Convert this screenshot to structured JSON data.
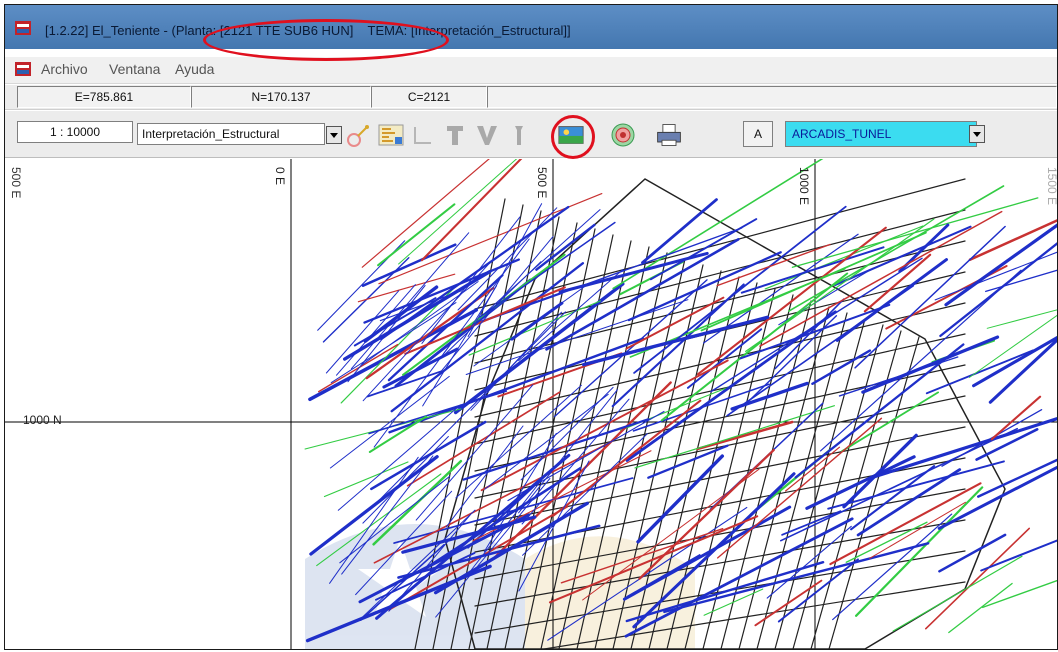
{
  "window": {
    "title_prefix": "[1.2.22] El_Teniente - ",
    "title_planta": "(Planta: [2121 TTE SUB6 HUN]",
    "title_tema": "    TEMA: [Interpretación_Estructural]]"
  },
  "menu": [
    "Archivo",
    "Ventana",
    "Ayuda"
  ],
  "status": {
    "east": "E=785.861",
    "north": "N=170.137",
    "cota": "C=2121"
  },
  "toolbar": {
    "scale": "1 : 10000",
    "theme_select": "Interpretación_Estructural",
    "font_button": "A",
    "layer_select": "ARCADIS_TUNEL"
  },
  "map": {
    "grid_labels": {
      "x_neg": "500 E",
      "x_zero": "0 E",
      "x_500": "500 E",
      "x_1000": "1000 E",
      "x_1500": "1500 E",
      "y_1000": "1000 N"
    }
  },
  "colors": {
    "title_bar": "#4a7db7",
    "highlight": "#e0101e",
    "layer_select_bg": "#3bdcf0",
    "tunnel_grid": "#222222",
    "structure_blue": "#1f2fc9",
    "structure_green": "#33cc44",
    "structure_red": "#c83232"
  }
}
